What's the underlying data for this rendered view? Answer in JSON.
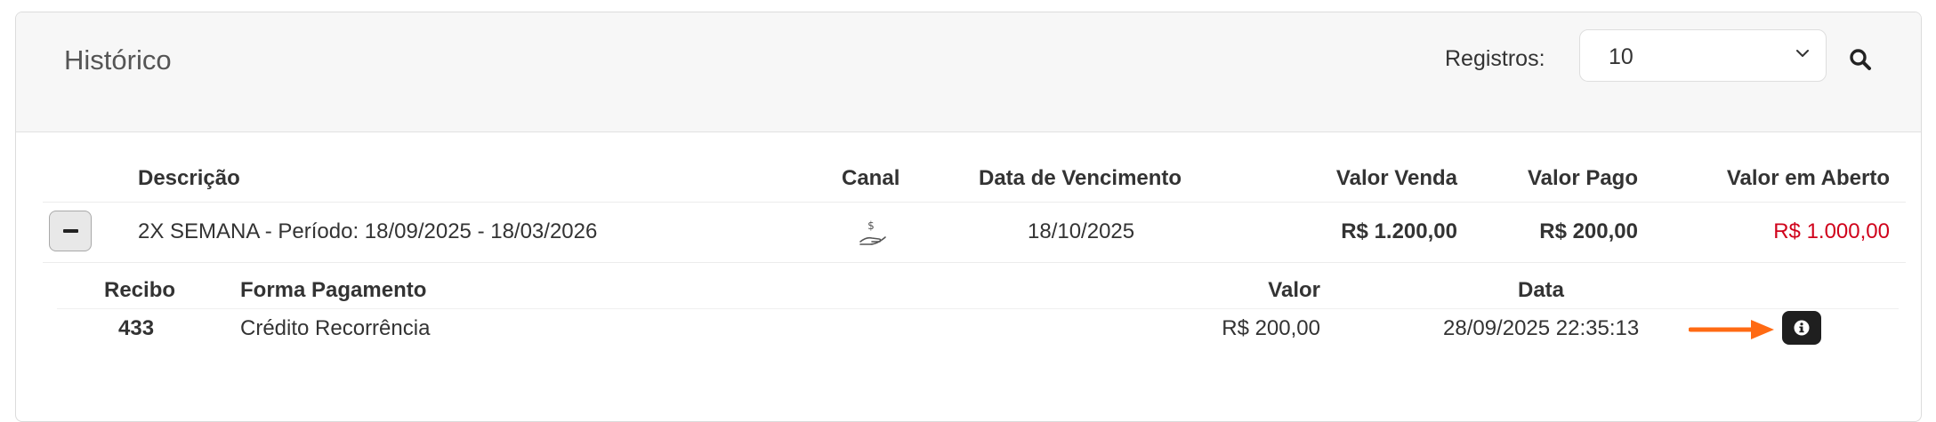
{
  "header": {
    "title": "Histórico",
    "records_label": "Registros:",
    "records_value": "10"
  },
  "table": {
    "columns": [
      "Descrição",
      "Canal",
      "Data de Vencimento",
      "Valor Venda",
      "Valor Pago",
      "Valor em Aberto"
    ],
    "rows": [
      {
        "descricao": "2X SEMANA - Período: 18/09/2025 - 18/03/2026",
        "canal_icon": "hand-money-icon",
        "vencimento": "18/10/2025",
        "valor_venda": "R$ 1.200,00",
        "valor_pago": "R$ 200,00",
        "valor_aberto": "R$ 1.000,00"
      }
    ]
  },
  "details": {
    "columns": [
      "Recibo",
      "Forma Pagamento",
      "Valor",
      "Data"
    ],
    "rows": [
      {
        "recibo": "433",
        "forma": "Crédito Recorrência",
        "valor": "R$ 200,00",
        "data": "28/09/2025 22:35:13"
      }
    ]
  },
  "colors": {
    "open_value": "#d0021b",
    "annotation_arrow": "#ff6a13",
    "info_button": "#1f1f1f"
  }
}
